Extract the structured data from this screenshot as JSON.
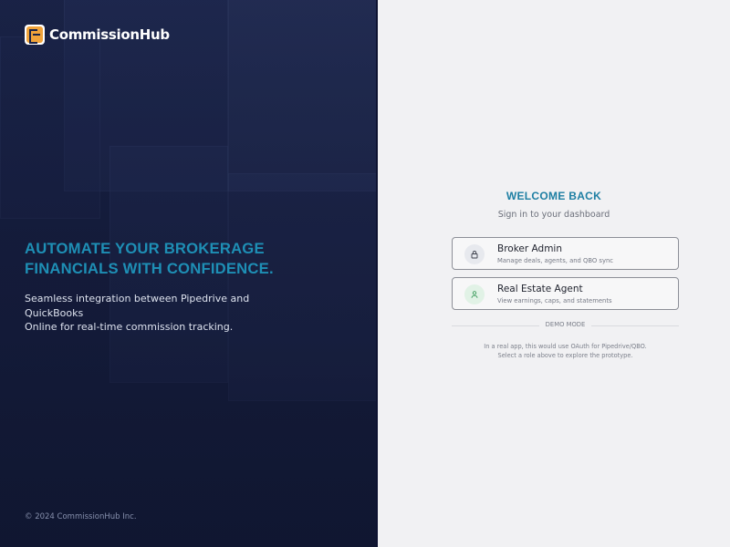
{
  "brand": {
    "name": "CommissionHub"
  },
  "hero": {
    "headline_line1": "AUTOMATE YOUR BROKERAGE",
    "headline_line2": "FINANCIALS WITH CONFIDENCE.",
    "subline_line1": "Seamless integration between Pipedrive and QuickBooks",
    "subline_line2": "Online for real-time commission tracking.",
    "copyright": "© 2024 CommissionHub Inc."
  },
  "login": {
    "title": "WELCOME BACK",
    "subtitle": "Sign in to your dashboard",
    "roles": [
      {
        "title": "Broker Admin",
        "description": "Manage deals, agents, and QBO sync",
        "icon": "lock-icon",
        "icon_bg": "#e7e9ee"
      },
      {
        "title": "Real Estate Agent",
        "description": "View earnings, caps, and statements",
        "icon": "user-icon",
        "icon_bg": "#e1f2e6"
      }
    ],
    "divider_label": "DEMO MODE",
    "note_line1": "In a real app, this would use OAuth for Pipedrive/QBO.",
    "note_line2": "Select a role above to explore the prototype."
  },
  "colors": {
    "accent": "#1e8fb5",
    "brand_mark": "#f0a33a",
    "left_bg": "#1a2347"
  }
}
